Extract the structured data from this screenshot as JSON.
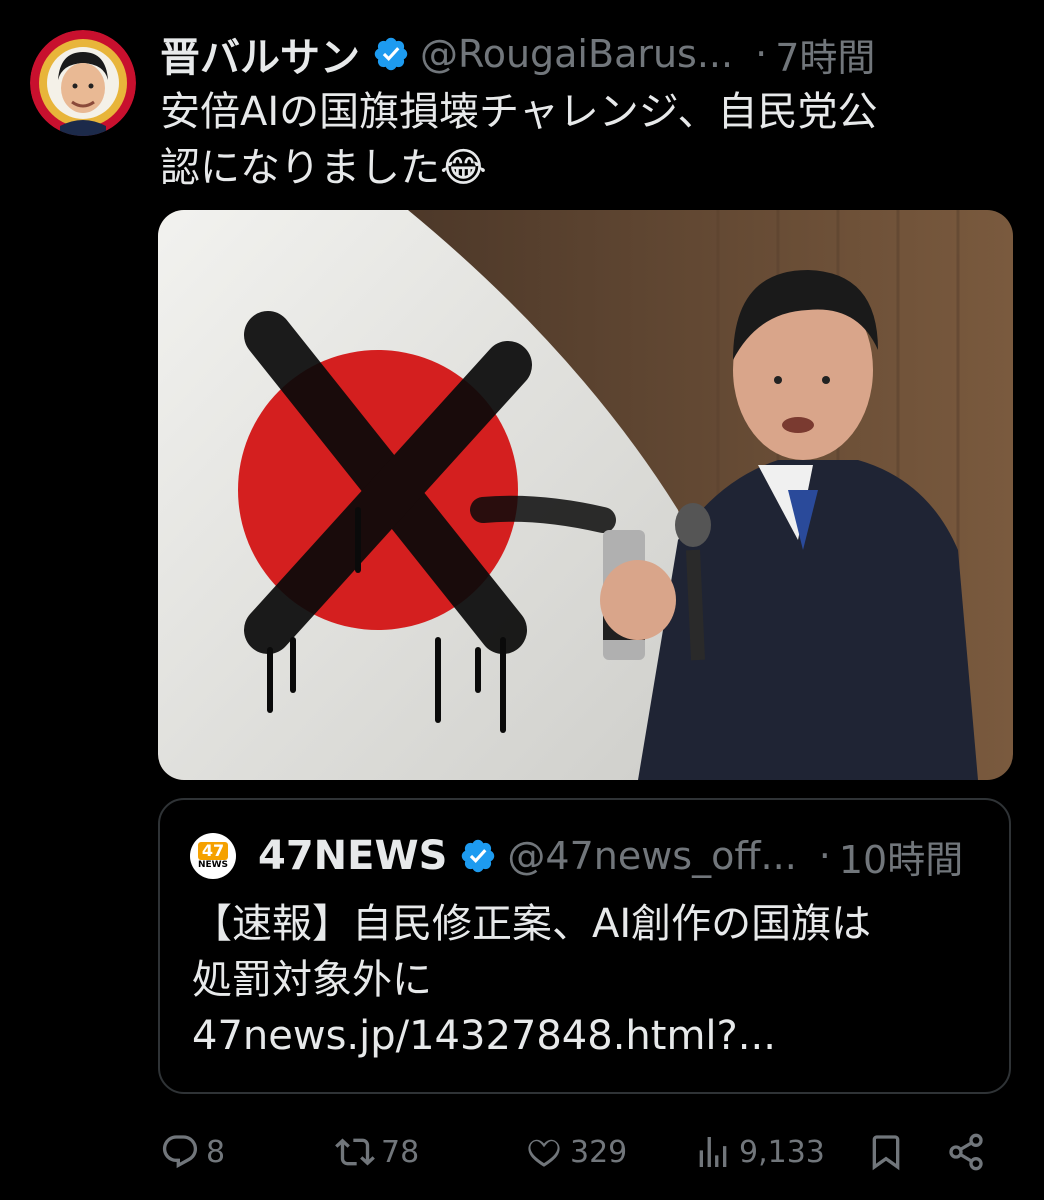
{
  "tweet": {
    "display_name": "晋バルサン",
    "handle": "@RougaiBarus...",
    "separator": "·",
    "time": "7時間",
    "text_line1": "安倍AIの国旗損壊チャレンジ、自民党公",
    "text_line2": "認になりました😂"
  },
  "quote": {
    "logo_number": "47",
    "logo_text": "NEWS",
    "display_name": "47NEWS",
    "handle": "@47news_off...",
    "separator": "·",
    "time": "10時間",
    "text_line1": "【速報】自民修正案、AI創作の国旗は",
    "text_line2": "処罰対象外に",
    "text_line3": "47news.jp/14327848.html?..."
  },
  "actions": {
    "reply_count": "8",
    "retweet_count": "78",
    "like_count": "329",
    "view_count": "9,133"
  },
  "icons": {
    "verified": "verified-badge-icon",
    "reply": "reply-icon",
    "retweet": "retweet-icon",
    "like": "heart-icon",
    "views": "views-icon",
    "bookmark": "bookmark-icon",
    "share": "share-icon"
  },
  "colors": {
    "background": "#000000",
    "text": "#e7e9ea",
    "muted": "#71767b",
    "verified": "#1d9bf0",
    "border": "#2f3336"
  }
}
